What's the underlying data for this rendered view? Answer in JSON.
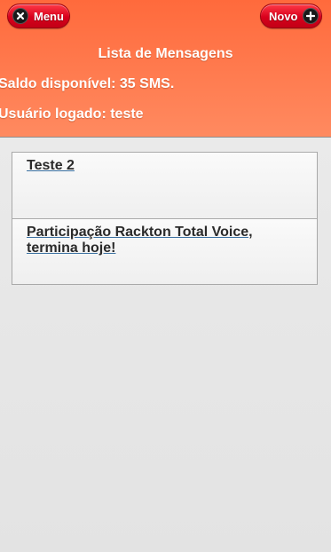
{
  "header": {
    "menu_label": "Menu",
    "menu_icon": "close-x-icon",
    "new_label": "Novo",
    "new_icon": "plus-icon",
    "title": "Lista de Mensagens",
    "balance_text": "Saldo disponível: 35 SMS.",
    "user_text": "Usuário logado: teste"
  },
  "messages": [
    {
      "title": "Teste 2"
    },
    {
      "title": "Participação Rackton Total Voice, termina hoje!"
    }
  ],
  "colors": {
    "header_top": "#ff6a3c",
    "header_bottom": "#ff8a60",
    "button_red": "#d8001c",
    "link_underline": "#3a6fa0"
  }
}
